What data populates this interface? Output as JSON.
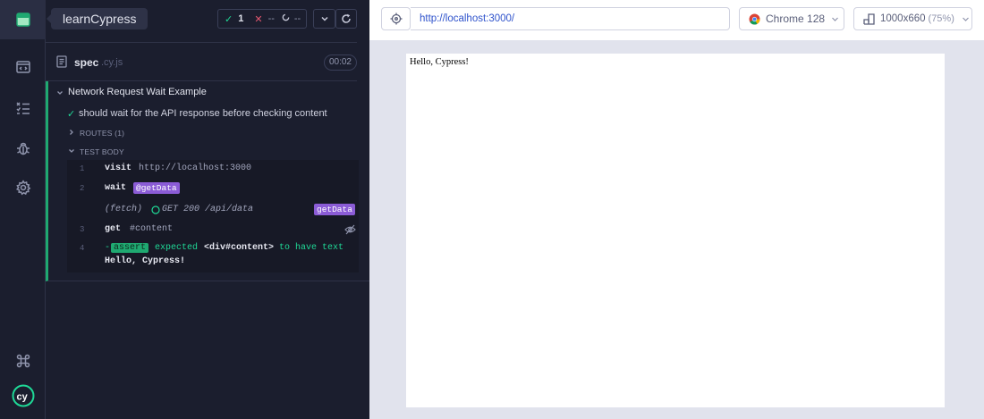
{
  "app": {
    "tooltip": "learnCypress"
  },
  "stats": {
    "passed": "1",
    "failed": "--",
    "pending": "--"
  },
  "spec": {
    "name": "spec",
    "ext": ".cy.js",
    "duration": "00:02"
  },
  "suite": {
    "title": "Network Request Wait Example",
    "test_title": "should wait for the API response before checking content",
    "routes_label": "ROUTES (1)",
    "body_label": "TEST BODY"
  },
  "commands": [
    {
      "num": "1",
      "name": "visit",
      "message": "http://localhost:3000"
    },
    {
      "num": "2",
      "name": "wait",
      "alias": "@getData"
    },
    {
      "event": "(fetch)",
      "message": "GET 200 /api/data",
      "alias": "getData"
    },
    {
      "num": "3",
      "name": "get",
      "message": "#content"
    },
    {
      "num": "4",
      "prefix": "-",
      "badge": "assert",
      "expected": "expected",
      "subject": "<div#content>",
      "to_have": "to have text",
      "value": "Hello, Cypress!"
    }
  ],
  "browser": {
    "url": "http://localhost:3000/",
    "name": "Chrome 128",
    "viewport": "1000x660",
    "scale": "(75%)"
  },
  "aut": {
    "content": "Hello, Cypress!"
  },
  "colors": {
    "passed": "#1fa971",
    "alias": "#8b5cd6",
    "url": "#2f53cc"
  }
}
